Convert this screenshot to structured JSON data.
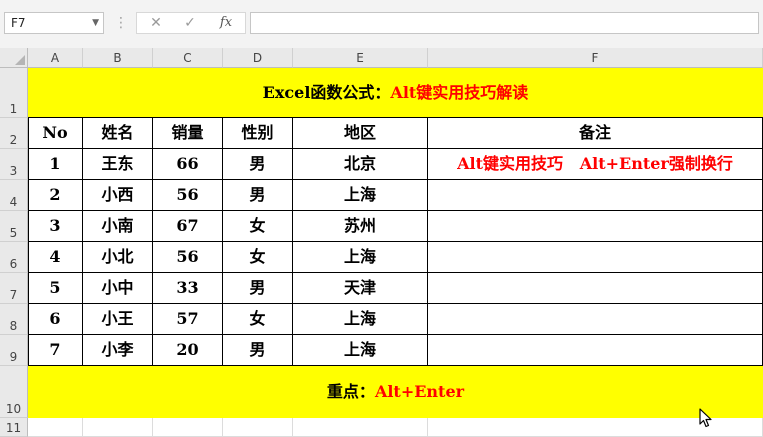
{
  "formula_bar": {
    "name_box": "F7",
    "fx_label": "fx",
    "formula": ""
  },
  "columns": [
    "A",
    "B",
    "C",
    "D",
    "E",
    "F"
  ],
  "rows": [
    "1",
    "2",
    "3",
    "4",
    "5",
    "6",
    "7",
    "8",
    "9",
    "10",
    "11"
  ],
  "title": {
    "black": "Excel函数公式：",
    "red": "Alt键实用技巧解读"
  },
  "table": {
    "headers": [
      "No",
      "姓名",
      "销量",
      "性别",
      "地区",
      "备注"
    ],
    "rows": [
      [
        "1",
        "王东",
        "66",
        "男",
        "北京",
        "Alt键实用技巧   Alt+Enter强制换行"
      ],
      [
        "2",
        "小西",
        "56",
        "男",
        "上海",
        ""
      ],
      [
        "3",
        "小南",
        "67",
        "女",
        "苏州",
        ""
      ],
      [
        "4",
        "小北",
        "56",
        "女",
        "上海",
        ""
      ],
      [
        "5",
        "小中",
        "33",
        "男",
        "天津",
        ""
      ],
      [
        "6",
        "小王",
        "57",
        "女",
        "上海",
        ""
      ],
      [
        "7",
        "小李",
        "20",
        "男",
        "上海",
        ""
      ]
    ]
  },
  "footer": {
    "black": "重点：",
    "red": "Alt+Enter"
  },
  "colors": {
    "banner": "#ffff00",
    "accent_red": "#ff0000",
    "header_bg": "#e9e9e9"
  }
}
